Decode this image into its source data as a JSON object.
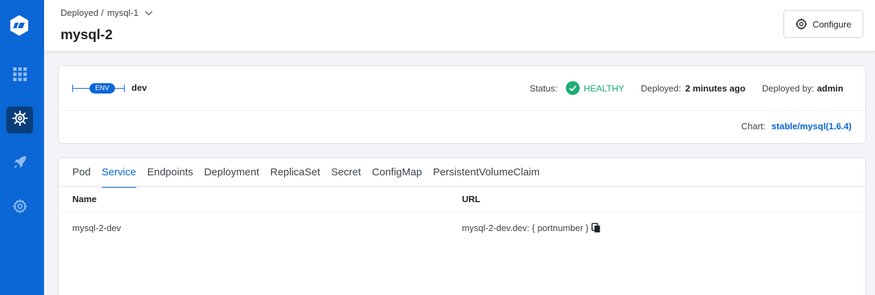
{
  "sidebar": {
    "items": [
      {
        "icon": "logo-icon"
      },
      {
        "icon": "apps-grid-icon"
      },
      {
        "icon": "helm-wheel-icon",
        "active": true
      },
      {
        "icon": "rocket-icon"
      },
      {
        "icon": "gear-icon"
      }
    ],
    "accent_color": "#0b66d6"
  },
  "header": {
    "breadcrumb_parent": "Deployed",
    "breadcrumb_sep": "/",
    "breadcrumb_current": "mysql-1",
    "title": "mysql-2",
    "configure_label": "Configure"
  },
  "env_card": {
    "env_badge": "ENV",
    "env_name": "dev",
    "status_label": "Status:",
    "status_value": "HEALTHY",
    "status_color": "#1dad70",
    "deployed_label": "Deployed:",
    "deployed_value": "2 minutes ago",
    "deployed_by_label": "Deployed by:",
    "deployed_by_value": "admin",
    "chart_label": "Chart:",
    "chart_value": "stable/mysql(1.6.4)"
  },
  "resources": {
    "tabs": [
      {
        "label": "Pod"
      },
      {
        "label": "Service",
        "active": true
      },
      {
        "label": "Endpoints"
      },
      {
        "label": "Deployment"
      },
      {
        "label": "ReplicaSet"
      },
      {
        "label": "Secret"
      },
      {
        "label": "ConfigMap"
      },
      {
        "label": "PersistentVolumeClaim"
      }
    ],
    "columns": [
      "Name",
      "URL"
    ],
    "rows": [
      {
        "name": "mysql-2-dev",
        "url": "mysql-2-dev.dev: { portnumber }"
      }
    ]
  }
}
